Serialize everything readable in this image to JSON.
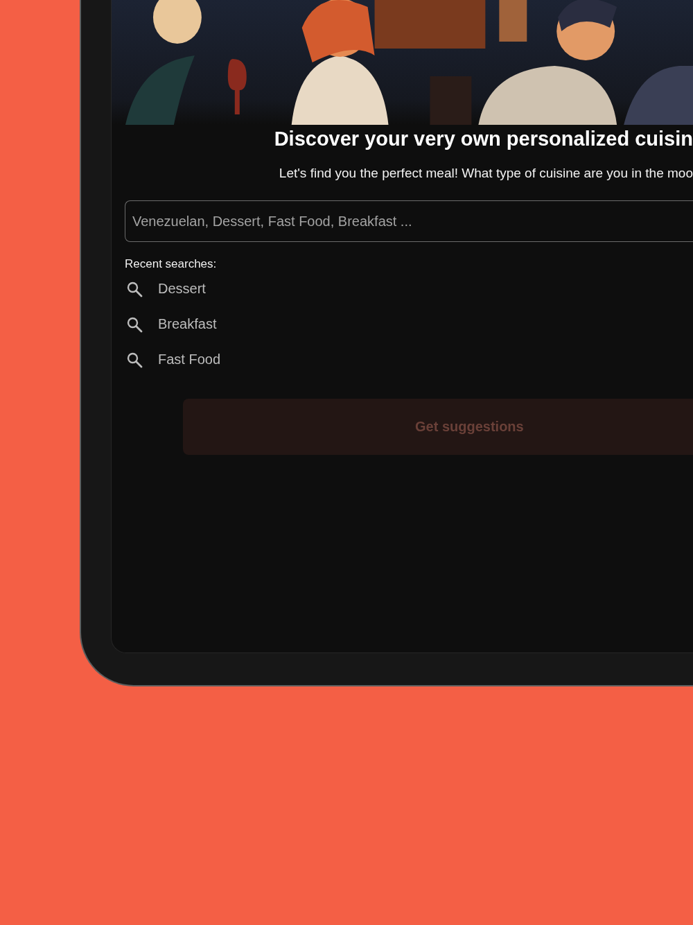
{
  "title": "Discover your very own personalized cuisin",
  "subtitle": "Let's find you the perfect meal! What type of cuisine are you in the moo",
  "search": {
    "placeholder": "Venezuelan, Dessert, Fast Food, Breakfast ..."
  },
  "recent_searches": {
    "label": "Recent searches:",
    "items": [
      "Dessert",
      "Breakfast",
      "Fast Food"
    ]
  },
  "submit_button": {
    "label": "Get suggestions",
    "disabled": true
  }
}
